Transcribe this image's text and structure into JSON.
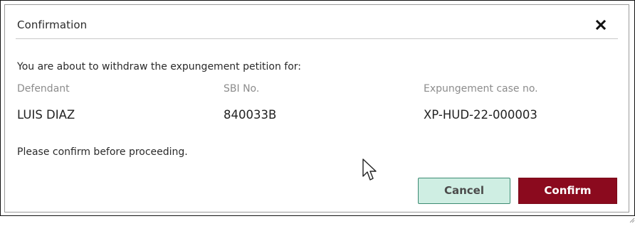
{
  "dialog": {
    "title": "Confirmation",
    "close_icon": "close-icon"
  },
  "body": {
    "intro": "You are about to withdraw the expungement petition for:",
    "fields": [
      {
        "label": "Defendant",
        "value": "LUIS DIAZ"
      },
      {
        "label": "SBI No.",
        "value": "840033B"
      },
      {
        "label": "Expungement case no.",
        "value": "XP-HUD-22-000003"
      }
    ],
    "confirm_note": "Please confirm before proceeding."
  },
  "buttons": {
    "cancel_label": "Cancel",
    "confirm_label": "Confirm"
  },
  "colors": {
    "confirm_bg": "#8b0a1e",
    "cancel_bg": "#cfeee3",
    "cancel_border": "#3d8b73"
  }
}
